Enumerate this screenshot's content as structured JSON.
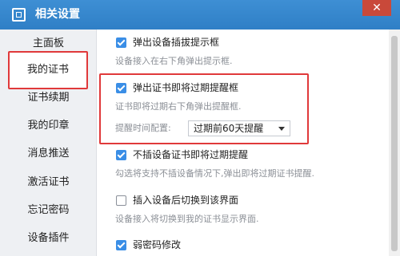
{
  "window": {
    "title": "相关设置",
    "close_glyph": "✕"
  },
  "sidebar": {
    "items": [
      {
        "label": "主面板"
      },
      {
        "label": "我的证书"
      },
      {
        "label": "证书续期"
      },
      {
        "label": "我的印章"
      },
      {
        "label": "消息推送"
      },
      {
        "label": "激活证书"
      },
      {
        "label": "忘记密码"
      },
      {
        "label": "设备插件"
      }
    ],
    "selected": "我的证书"
  },
  "settings": {
    "options": [
      {
        "label": "弹出设备插拔提示框",
        "checked": true,
        "description": "设备接入在右下角弹出提示框."
      },
      {
        "label": "弹出证书即将过期提醒框",
        "checked": true,
        "description": "证书即将过期右下角弹出提醒框."
      },
      {
        "label": "不插设备证书即将过期提醒",
        "checked": true,
        "description": "勾选将支持不插设备情况下,弹出即将过期证书提醒."
      },
      {
        "label": "插入设备后切换到该界面",
        "checked": false,
        "description": "设备接入将切换到我的证书显示界面."
      },
      {
        "label": "弱密码修改",
        "checked": true
      }
    ],
    "reminder": {
      "label": "提醒时间配置:",
      "selected": "过期前60天提醒"
    }
  },
  "colors": {
    "accent": "#3a8ee6",
    "titlebar": "#2f7fc6",
    "highlight": "#e0393a",
    "close": "#c9493a"
  }
}
